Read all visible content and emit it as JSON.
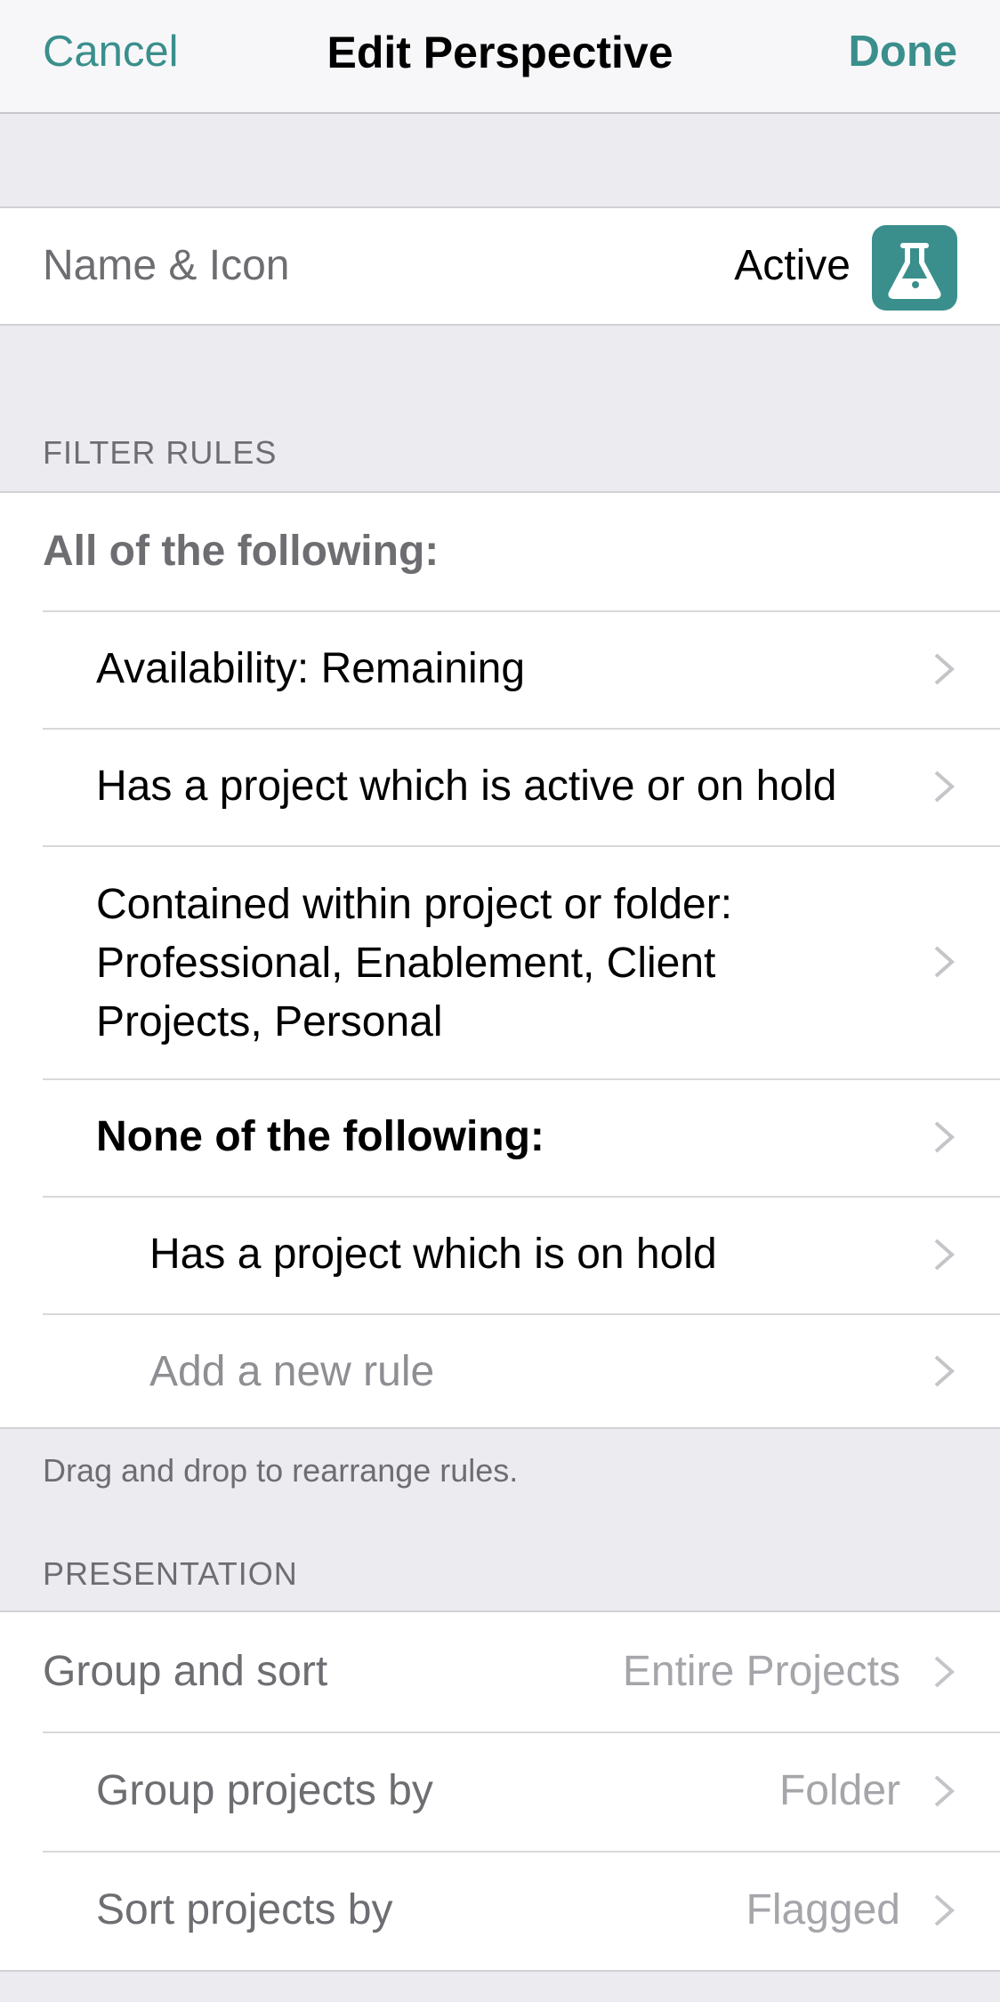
{
  "navbar": {
    "cancel_label": "Cancel",
    "title": "Edit Perspective",
    "done_label": "Done"
  },
  "name_icon": {
    "label": "Name & Icon",
    "value": "Active",
    "icon": "flask-icon",
    "icon_color": "#3a8f8c"
  },
  "filter_rules": {
    "header": "FILTER RULES",
    "all_label": "All of the following:",
    "rules": [
      "Availability: Remaining",
      "Has a project which is active or on hold",
      [
        "Contained within project or folder:",
        "Professional, Enablement, Client",
        "Projects, Personal"
      ],
      "None of the following:",
      "Has a project which is on hold",
      "Add a new rule"
    ],
    "footer": "Drag and drop to rearrange rules."
  },
  "presentation": {
    "header": "PRESENTATION",
    "rows": [
      {
        "label": "Group and sort",
        "value": "Entire Projects"
      },
      {
        "label": "Group projects by",
        "value": "Folder"
      },
      {
        "label": "Sort projects by",
        "value": "Flagged"
      }
    ]
  },
  "colors": {
    "accent": "#3a8f8c",
    "background": "#ebebf0",
    "secondary_text": "#6d6d72",
    "placeholder_text": "#a5a5aa"
  }
}
